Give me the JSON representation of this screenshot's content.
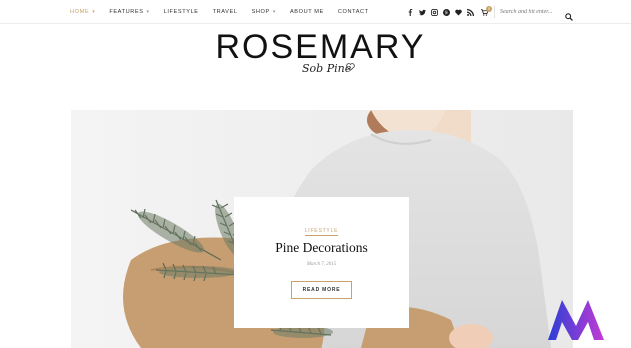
{
  "nav": {
    "items": [
      {
        "label": "Home",
        "active": true,
        "dropdown": true
      },
      {
        "label": "Features",
        "active": false,
        "dropdown": true
      },
      {
        "label": "Lifestyle",
        "active": false,
        "dropdown": false
      },
      {
        "label": "Travel",
        "active": false,
        "dropdown": false
      },
      {
        "label": "Shop",
        "active": false,
        "dropdown": true
      },
      {
        "label": "About Me",
        "active": false,
        "dropdown": false
      },
      {
        "label": "Contact",
        "active": false,
        "dropdown": false
      }
    ],
    "caret": "⌄"
  },
  "social": {
    "icons": [
      "facebook-icon",
      "twitter-icon",
      "instagram-icon",
      "pinterest-icon",
      "heart-icon",
      "rss-icon"
    ],
    "cart_icon": "cart-icon",
    "cart_count": "0"
  },
  "search": {
    "placeholder": "Search and hit enter..."
  },
  "site": {
    "title": "ROSEMARY",
    "tagline": "Sob Pine"
  },
  "featured": {
    "category": "Lifestyle",
    "title": "Pine Decorations",
    "date": "March 7, 2015",
    "button_label": "Read More"
  },
  "colors": {
    "accent": "#c9a26b",
    "text": "#222222",
    "muted": "#999999",
    "brand_logo_blue": "#2b3fd6",
    "brand_logo_purple": "#c23bd4"
  }
}
